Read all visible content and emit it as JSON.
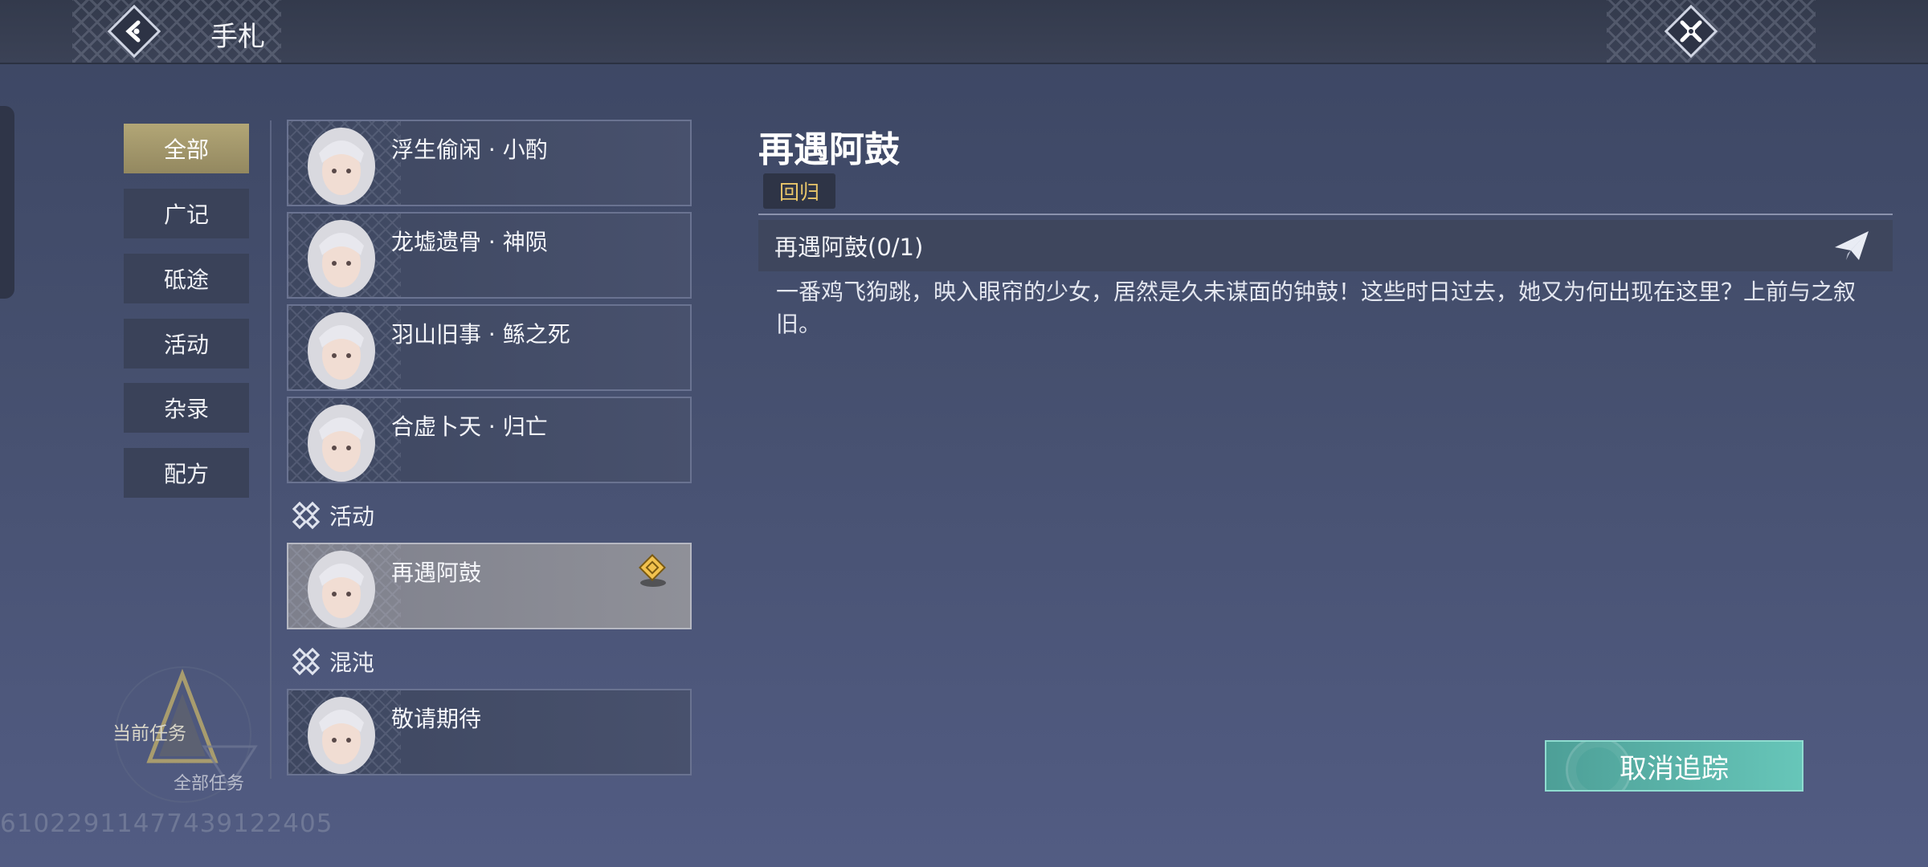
{
  "header": {
    "title": "手札"
  },
  "categories": [
    {
      "label": "全部",
      "active": true
    },
    {
      "label": "广记"
    },
    {
      "label": "砥途"
    },
    {
      "label": "活动"
    },
    {
      "label": "杂录"
    },
    {
      "label": "配方"
    }
  ],
  "quests": {
    "group0": [
      "浮生偷闲 · 小酌",
      "龙墟遗骨 · 神陨",
      "羽山旧事 · 鲧之死",
      "合虚卜天 · 归亡"
    ],
    "section1": "活动",
    "group1": [
      "再遇阿鼓"
    ],
    "section2": "混沌",
    "group2": [
      "敬请期待"
    ]
  },
  "detail": {
    "title": "再遇阿鼓",
    "tag": "回归",
    "objective": "再遇阿鼓(0/1)",
    "description": "一番鸡飞狗跳，映入眼帘的少女，居然是久未谋面的钟鼓！这些时日过去，她又为何出现在这里？上前与之叙旧。",
    "cancel_button": "取消追踪"
  },
  "current_task": {
    "label": "当前任务",
    "all_label": "全部任务"
  },
  "uid": "6102291147743912240​5",
  "colors": {
    "accent_gold": "#e9c66a",
    "button_teal": "#5fb8ad",
    "active_tab": "#a89c6e"
  }
}
